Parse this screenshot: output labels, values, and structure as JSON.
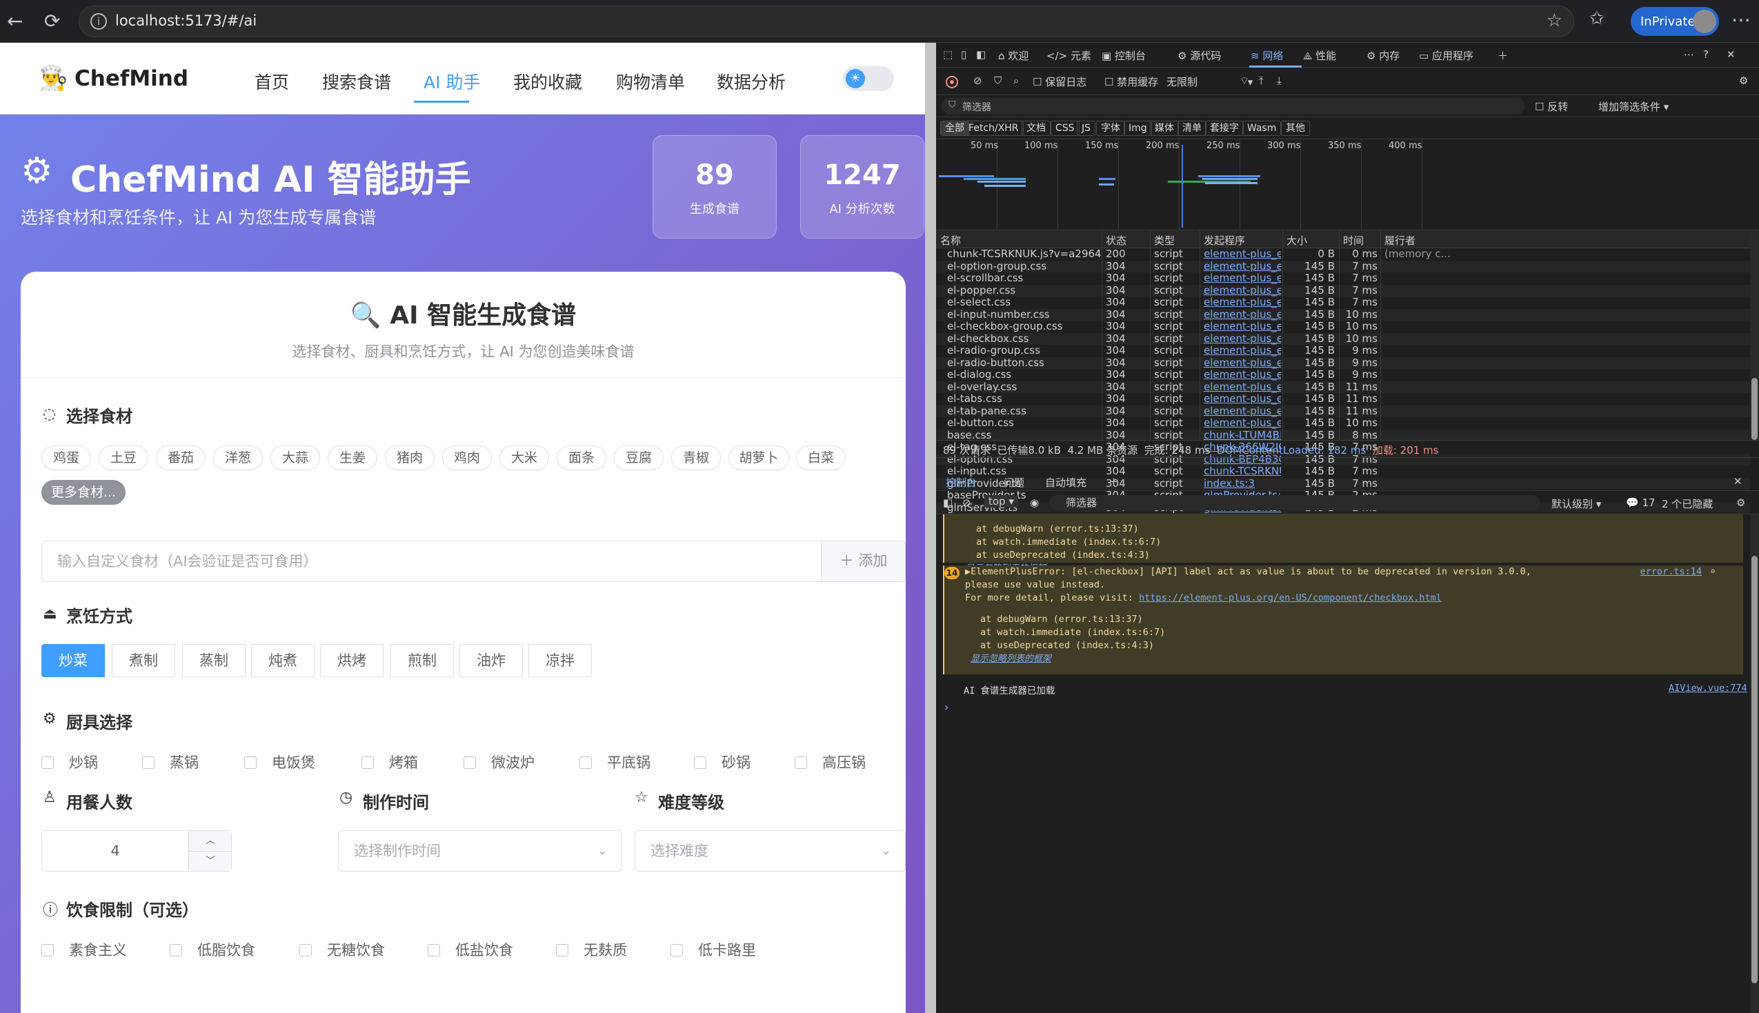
{
  "browser": {
    "url": "localhost:5173/#/ai",
    "inprivate_label": "InPrivate"
  },
  "app": {
    "brand": "ChefMind",
    "nav": [
      "首页",
      "搜索食谱",
      "AI 助手",
      "我的收藏",
      "购物清单",
      "数据分析"
    ],
    "active_nav": "AI 助手",
    "hero": {
      "title": "ChefMind AI 智能助手",
      "subtitle": "选择食材和烹饪条件，让 AI 为您生成专属食谱",
      "stats": [
        {
          "value": "89",
          "label": "生成食谱"
        },
        {
          "value": "1247",
          "label": "AI 分析次数"
        }
      ]
    },
    "card": {
      "title": "AI 智能生成食谱",
      "subtitle": "选择食材、厨具和烹饪方式，让 AI 为您创造美味食谱",
      "ingredients": {
        "title": "选择食材",
        "tags": [
          "鸡蛋",
          "土豆",
          "番茄",
          "洋葱",
          "大蒜",
          "生姜",
          "猪肉",
          "鸡肉",
          "大米",
          "面条",
          "豆腐",
          "青椒",
          "胡萝卜",
          "白菜"
        ],
        "more": "更多食材...",
        "input_placeholder": "输入自定义食材（AI会验证是否可食用）",
        "add_label": "添加"
      },
      "cooking": {
        "title": "烹饪方式",
        "options": [
          "炒菜",
          "煮制",
          "蒸制",
          "炖煮",
          "烘烤",
          "煎制",
          "油炸",
          "凉拌"
        ],
        "selected": "炒菜"
      },
      "cookware": {
        "title": "厨具选择",
        "options": [
          "炒锅",
          "蒸锅",
          "电饭煲",
          "烤箱",
          "微波炉",
          "平底锅",
          "砂锅",
          "高压锅"
        ]
      },
      "people": {
        "title": "用餐人数",
        "value": "4"
      },
      "time": {
        "title": "制作时间",
        "placeholder": "选择制作时间"
      },
      "difficulty": {
        "title": "难度等级",
        "placeholder": "选择难度"
      },
      "diet": {
        "title": "饮食限制（可选）",
        "options": [
          "素食主义",
          "低脂饮食",
          "无糖饮食",
          "低盐饮食",
          "无麸质",
          "低卡路里"
        ]
      }
    }
  },
  "devtools": {
    "tabs": [
      "欢迎",
      "元素",
      "控制台",
      "源代码",
      "网络",
      "性能",
      "内存",
      "应用程序"
    ],
    "active_tab": "网络",
    "toolbar": {
      "preserve_log": "保留日志",
      "disable_cache": "禁用缓存",
      "throttle": "无限制"
    },
    "filter_placeholder": "筛选器",
    "invert": "反转",
    "more_filters": "增加筛选条件",
    "types": [
      "全部",
      "Fetch/XHR",
      "文档",
      "CSS",
      "JS",
      "字体",
      "Img",
      "媒体",
      "清单",
      "套接字",
      "Wasm",
      "其他"
    ],
    "timeline_ticks": [
      "50 ms",
      "100 ms",
      "150 ms",
      "200 ms",
      "250 ms",
      "300 ms",
      "350 ms",
      "400 ms"
    ],
    "columns": [
      "名称",
      "状态",
      "类型",
      "发起程序",
      "大小",
      "时间",
      "履行者"
    ],
    "rows": [
      [
        "chunk-TCSRKNUK.js?v=a2964a46",
        "200",
        "script",
        "element-plus_es_compo",
        "0 B",
        "0 ms",
        "(memory c..."
      ],
      [
        "el-option-group.css",
        "304",
        "script",
        "element-plus_es_compo",
        "145 B",
        "7 ms",
        ""
      ],
      [
        "el-scrollbar.css",
        "304",
        "script",
        "element-plus_es_compo",
        "145 B",
        "7 ms",
        ""
      ],
      [
        "el-popper.css",
        "304",
        "script",
        "element-plus_es_compo",
        "145 B",
        "7 ms",
        ""
      ],
      [
        "el-select.css",
        "304",
        "script",
        "element-plus_es_compo",
        "145 B",
        "7 ms",
        ""
      ],
      [
        "el-input-number.css",
        "304",
        "script",
        "element-plus_es_compo",
        "145 B",
        "10 ms",
        ""
      ],
      [
        "el-checkbox-group.css",
        "304",
        "script",
        "element-plus_es_compo",
        "145 B",
        "10 ms",
        ""
      ],
      [
        "el-checkbox.css",
        "304",
        "script",
        "element-plus_es_compo",
        "145 B",
        "10 ms",
        ""
      ],
      [
        "el-radio-group.css",
        "304",
        "script",
        "element-plus_es_compo",
        "145 B",
        "9 ms",
        ""
      ],
      [
        "el-radio-button.css",
        "304",
        "script",
        "element-plus_es_compo",
        "145 B",
        "9 ms",
        ""
      ],
      [
        "el-dialog.css",
        "304",
        "script",
        "element-plus_es_compo",
        "145 B",
        "9 ms",
        ""
      ],
      [
        "el-overlay.css",
        "304",
        "script",
        "element-plus_es_compo",
        "145 B",
        "11 ms",
        ""
      ],
      [
        "el-tabs.css",
        "304",
        "script",
        "element-plus_es_compo",
        "145 B",
        "11 ms",
        ""
      ],
      [
        "el-tab-pane.css",
        "304",
        "script",
        "element-plus_es_compo",
        "145 B",
        "11 ms",
        ""
      ],
      [
        "el-button.css",
        "304",
        "script",
        "element-plus_es_compo",
        "145 B",
        "10 ms",
        ""
      ],
      [
        "base.css",
        "304",
        "script",
        "chunk-LTUM4BR5.js?v=a",
        "145 B",
        "8 ms",
        ""
      ],
      [
        "el-tag.css",
        "304",
        "script",
        "chunk-366W2IOK.js?v=a",
        "145 B",
        "7 ms",
        ""
      ],
      [
        "el-option.css",
        "304",
        "script",
        "chunk-BEP4B3OT.js?v=a",
        "145 B",
        "7 ms",
        ""
      ],
      [
        "el-input.css",
        "304",
        "script",
        "chunk-TCSRKNUK.js?v=a",
        "145 B",
        "7 ms",
        ""
      ],
      [
        "glmProvider.ts",
        "304",
        "script",
        "index.ts:3",
        "145 B",
        "7 ms",
        ""
      ],
      [
        "baseProvider.ts",
        "304",
        "script",
        "glmProvider.ts:1",
        "145 B",
        "2 ms",
        ""
      ],
      [
        "glmService.ts",
        "304",
        "script",
        "glmProvider.ts:1",
        "145 B",
        "2 ms",
        ""
      ]
    ],
    "summary": {
      "requests": "89 次请求",
      "transferred": "已传输8.0 kB",
      "resources": "4.2 MB 条资源",
      "finish": "完成: 248 ms",
      "dcl": "DOMContentLoaded: 182 ms",
      "load": "加载: 201 ms"
    },
    "drawer_tabs": [
      "控制台",
      "问题",
      "自动填充"
    ],
    "console_toolbar": {
      "context": "top",
      "filter": "筛选器",
      "level": "默认级别",
      "count": "17",
      "hidden": "2 个已隐藏"
    },
    "console": {
      "stack_top": [
        "at debugWarn (error.ts:13:37)",
        "at watch.immediate (index.ts:6:7)",
        "at useDeprecated (index.ts:4:3)"
      ],
      "show_ignored": "显示忽略列表的框架",
      "badge": "14",
      "error_line1": "▶ElementPlusError: [el-checkbox] [API] label act as value is about to be deprecated in version 3.0.0,",
      "error_line2": "please use value instead.",
      "error_line3a": "For more detail, please visit: ",
      "error_link": "https://element-plus.org/en-US/component/checkbox.html",
      "error_src": "error.ts:14",
      "stack": [
        "at debugWarn (error.ts:13:37)",
        "at watch.immediate (index.ts:6:7)",
        "at useDeprecated (index.ts:4:3)"
      ],
      "info": "AI 食谱生成器已加载",
      "info_src": "AIView.vue:774"
    }
  }
}
